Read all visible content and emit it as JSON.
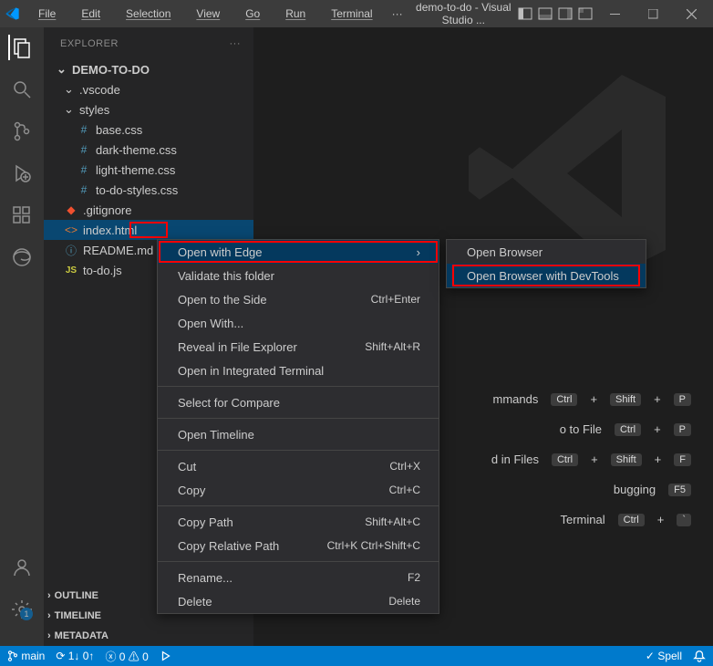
{
  "title": "demo-to-do - Visual Studio ...",
  "menu": {
    "file": "File",
    "edit": "Edit",
    "selection": "Selection",
    "view": "View",
    "go": "Go",
    "run": "Run",
    "terminal": "Terminal",
    "more": "···"
  },
  "explorer": {
    "title": "EXPLORER",
    "project": "DEMO-TO-DO",
    "tree": [
      {
        "name": ".vscode"
      },
      {
        "name": "styles"
      },
      {
        "name": "base.css"
      },
      {
        "name": "dark-theme.css"
      },
      {
        "name": "light-theme.css"
      },
      {
        "name": "to-do-styles.css"
      },
      {
        "name": ".gitignore"
      },
      {
        "name": "index.html"
      },
      {
        "name": "README.md"
      },
      {
        "name": "to-do.js"
      }
    ],
    "sections": {
      "outline": "OUTLINE",
      "timeline": "TIMELINE",
      "metadata": "METADATA"
    }
  },
  "context_main": [
    {
      "label": "Open with Edge",
      "sub": true,
      "hover": true
    },
    {
      "label": "Validate this folder"
    },
    {
      "label": "Open to the Side",
      "shortcut": "Ctrl+Enter"
    },
    {
      "label": "Open With..."
    },
    {
      "label": "Reveal in File Explorer",
      "shortcut": "Shift+Alt+R"
    },
    {
      "label": "Open in Integrated Terminal"
    },
    {
      "sep": true
    },
    {
      "label": "Select for Compare"
    },
    {
      "sep": true
    },
    {
      "label": "Open Timeline"
    },
    {
      "sep": true
    },
    {
      "label": "Cut",
      "shortcut": "Ctrl+X"
    },
    {
      "label": "Copy",
      "shortcut": "Ctrl+C"
    },
    {
      "sep": true
    },
    {
      "label": "Copy Path",
      "shortcut": "Shift+Alt+C"
    },
    {
      "label": "Copy Relative Path",
      "shortcut": "Ctrl+K Ctrl+Shift+C"
    },
    {
      "sep": true
    },
    {
      "label": "Rename...",
      "shortcut": "F2"
    },
    {
      "label": "Delete",
      "shortcut": "Delete"
    }
  ],
  "context_sub": [
    {
      "label": "Open Browser"
    },
    {
      "label": "Open Browser with DevTools",
      "hover": true
    }
  ],
  "getting_started": [
    {
      "label": "mmands",
      "keys": [
        "Ctrl",
        "+",
        "Shift",
        "+",
        "P"
      ]
    },
    {
      "label": "o to File",
      "keys": [
        "Ctrl",
        "+",
        "P"
      ]
    },
    {
      "label": "d in Files",
      "keys": [
        "Ctrl",
        "+",
        "Shift",
        "+",
        "F"
      ]
    },
    {
      "label": "bugging",
      "keys": [
        "F5"
      ]
    },
    {
      "label": "Terminal",
      "keys": [
        "Ctrl",
        "+",
        "`"
      ]
    }
  ],
  "status": {
    "branch": "main",
    "sync": "1↓ 0↑",
    "errors": "0",
    "warnings": "0",
    "spell": "Spell"
  },
  "settings_badge": "1"
}
